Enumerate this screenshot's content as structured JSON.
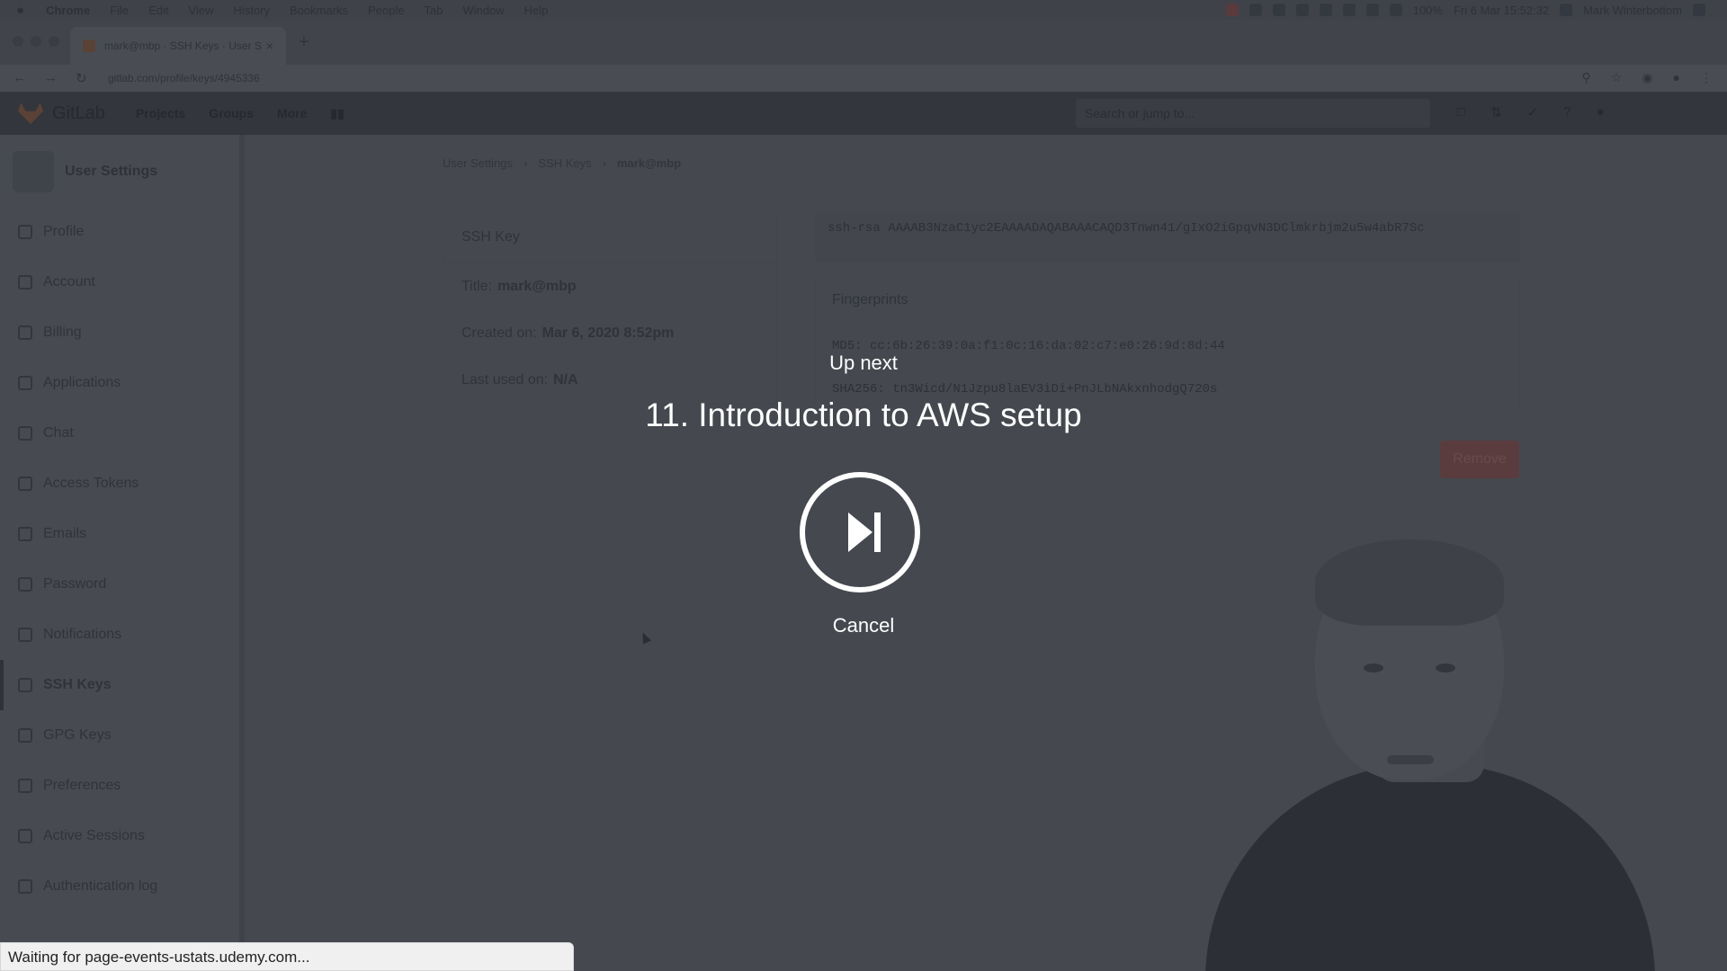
{
  "menubar": {
    "app": "Chrome",
    "items": [
      "File",
      "Edit",
      "View",
      "History",
      "Bookmarks",
      "People",
      "Tab",
      "Window",
      "Help"
    ],
    "battery": "100%",
    "clock": "Fri 6 Mar 15:52:32",
    "user": "Mark Winterbottom"
  },
  "browser": {
    "tab_title": "mark@mbp · SSH Keys · User S",
    "url": "gitlab.com/profile/keys/4945336"
  },
  "gitlab": {
    "brand": "GitLab",
    "nav": [
      "Projects",
      "Groups",
      "More"
    ],
    "search_placeholder": "Search or jump to..."
  },
  "sidebar": {
    "title": "User Settings",
    "items": [
      {
        "label": "Profile",
        "icon": "profile-icon"
      },
      {
        "label": "Account",
        "icon": "account-icon"
      },
      {
        "label": "Billing",
        "icon": "billing-icon"
      },
      {
        "label": "Applications",
        "icon": "applications-icon"
      },
      {
        "label": "Chat",
        "icon": "chat-icon"
      },
      {
        "label": "Access Tokens",
        "icon": "token-icon"
      },
      {
        "label": "Emails",
        "icon": "email-icon"
      },
      {
        "label": "Password",
        "icon": "lock-icon"
      },
      {
        "label": "Notifications",
        "icon": "bell-icon"
      },
      {
        "label": "SSH Keys",
        "icon": "key-icon",
        "active": true
      },
      {
        "label": "GPG Keys",
        "icon": "key-icon"
      },
      {
        "label": "Preferences",
        "icon": "preferences-icon"
      },
      {
        "label": "Active Sessions",
        "icon": "monitor-icon"
      },
      {
        "label": "Authentication log",
        "icon": "log-icon"
      }
    ]
  },
  "breadcrumb": [
    "User Settings",
    "SSH Keys",
    "mark@mbp"
  ],
  "ssh_key": {
    "header": "SSH Key",
    "title_label": "Title:",
    "title_value": "mark@mbp",
    "created_label": "Created on:",
    "created_value": "Mar 6, 2020 8:52pm",
    "last_used_label": "Last used on:",
    "last_used_value": "N/A",
    "key_text": "ssh-rsa AAAAB3NzaC1yc2EAAAADAQABAAACAQD3Tnwn41/gIxO2iGpqvN3DClmkrbjm2u5w4abR7Sc",
    "fingerprints_header": "Fingerprints",
    "md5": "MD5: cc:6b:26:39:0a:f1:0c:16:da:02:c7:e0:26:9d:8d:44",
    "sha256": "SHA256: tn3Wicd/N1Jzpu8laEV3iDi+PnJLbNAkxnhodgQ720s",
    "remove_label": "Remove"
  },
  "overlay": {
    "up_next": "Up next",
    "next_title": "11. Introduction to AWS setup",
    "cancel": "Cancel"
  },
  "status_bar": "Waiting for page-events-ustats.udemy.com..."
}
